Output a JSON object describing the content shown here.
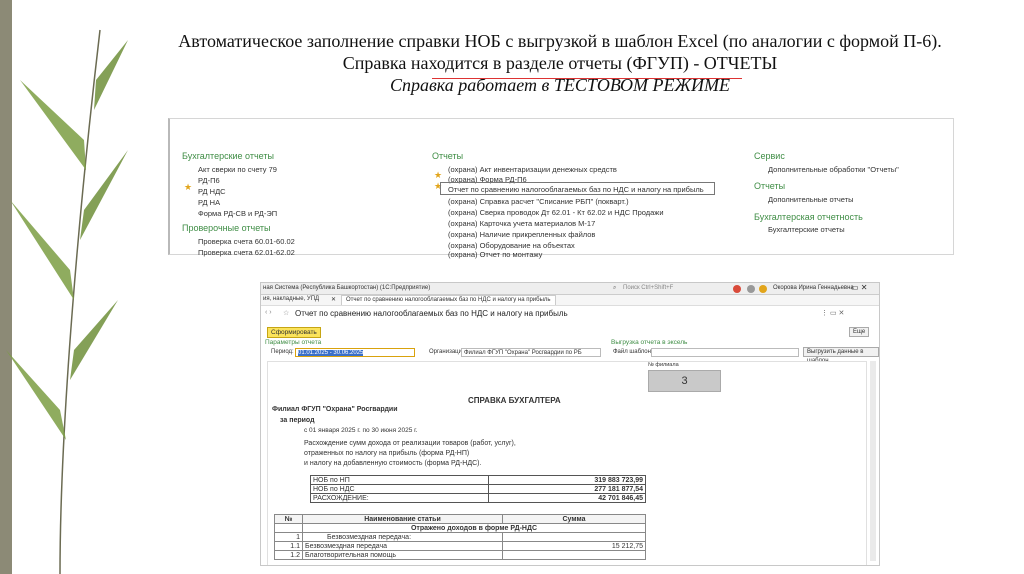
{
  "slide": {
    "title_line1": "Автоматическое заполнение справки НОБ с выгрузкой в шаблон Excel (по аналогии с формой П-6).",
    "title_line2": "Справка находится в разделе   отчеты (ФГУП) - ОТЧЕТЫ",
    "title_line3": "Справка работает в ТЕСТОВОМ РЕЖИМЕ"
  },
  "menu": {
    "col1": {
      "heading": "Бухгалтерские отчеты",
      "items": [
        "Акт сверки по счету 79",
        "РД-П6",
        "РД НДС",
        "РД НА",
        "Форма РД-СВ и РД-ЭП"
      ],
      "heading2": "Проверочные отчеты",
      "items2": [
        "Проверка счета 60.01-60.02",
        "Проверка счета 62.01-62.02"
      ]
    },
    "col2": {
      "heading": "Отчеты",
      "items": [
        "(охрана) Акт инвентаризации денежных средств",
        "(охрана) Форма РД-П6",
        "Отчет по сравнению налогооблагаемых баз по НДС и налогу на прибыль",
        "(охрана) Справка расчет \"Списание РБП\" (покварт.)",
        "(охрана) Сверка проводок Дт 62.01 - Кт 62.02 и НДС Продажи",
        "(охрана) Карточка учета материалов М-17",
        "(охрана) Наличие прикрепленных файлов",
        "(охрана) Оборудование на объектах",
        "(охрана) Отчет по монтажу"
      ]
    },
    "col3": {
      "heading": "Сервис",
      "items": [
        "Дополнительные обработки \"Отчеты\""
      ],
      "heading2": "Отчеты",
      "items2": [
        "Дополнительные отчеты"
      ],
      "heading3": "Бухгалтерская отчетность",
      "items3": [
        "Бухгалтерские отчеты"
      ]
    }
  },
  "app": {
    "window_title": "ная Система (Республика Башкортостан) (1С:Предприятие)",
    "search_placeholder": "Поиск Ctrl+Shift+F",
    "user_name": "Окорова Ирина Геннадьевна",
    "tab_left": "ия, накладные, УПД",
    "tab_active": "Отчет по сравнению налогооблагаемых баз по НДС и налогу на прибыль",
    "report_title": "Отчет по сравнению налогооблагаемых баз по НДС и налогу на прибыль",
    "generate_button": "Сформировать",
    "more_button": "Еще",
    "params_label": "Параметры отчета",
    "period_label": "Период:",
    "period_value": "01.01.2025 - 30.06.2025",
    "org_label": "Организация:",
    "org_value": "Филиал ФГУП \"Охрана\" Росгвардии по РБ",
    "export_label": "Выгрузка отчета в эксель",
    "template_label": "Файл шаблона:",
    "export_button": "Выгрузить данные в шаблон",
    "branch_no_label": "№ филиала",
    "branch_no_value": "3",
    "report_heading": "СПРАВКА  БУХГАЛТЕРА",
    "org_name": "Филиал ФГУП \"Охрана\" Росгвардии",
    "period_heading": "за период",
    "period_text": "с 01 января 2025 г. по 30 июня 2025 г.",
    "desc1": "Расхождение сумм дохода от реализации товаров (работ, услуг),",
    "desc2": "отраженных по налогу на прибыль (форма РД-НП)",
    "desc3": "и налогу на добавленную стоимость (форма РД-НДС).",
    "summary": [
      {
        "label": "НОБ по НП",
        "value": "319 883 723,99"
      },
      {
        "label": "НОБ по НДС",
        "value": "277 181 877,54"
      },
      {
        "label": "РАСХОЖДЕНИЕ:",
        "value": "42 701 846,45"
      }
    ],
    "table_head": [
      "№",
      "Наименование статьи",
      "Сумма"
    ],
    "section_title": "Отражено доходов в форме РД-НДС",
    "rows": [
      {
        "no": "1",
        "name": "Безвозмездная передача:",
        "sum": ""
      },
      {
        "no": "1.1",
        "name": "Безвозмездная передача",
        "sum": "15 212,75"
      },
      {
        "no": "1.2",
        "name": "Благотворительная помощь",
        "sum": ""
      }
    ]
  },
  "colors": {
    "accent_green": "#3f8d45",
    "star": "#e2a51b",
    "highlight_red": "#d33333",
    "button_yellow": "#fbe35b"
  }
}
